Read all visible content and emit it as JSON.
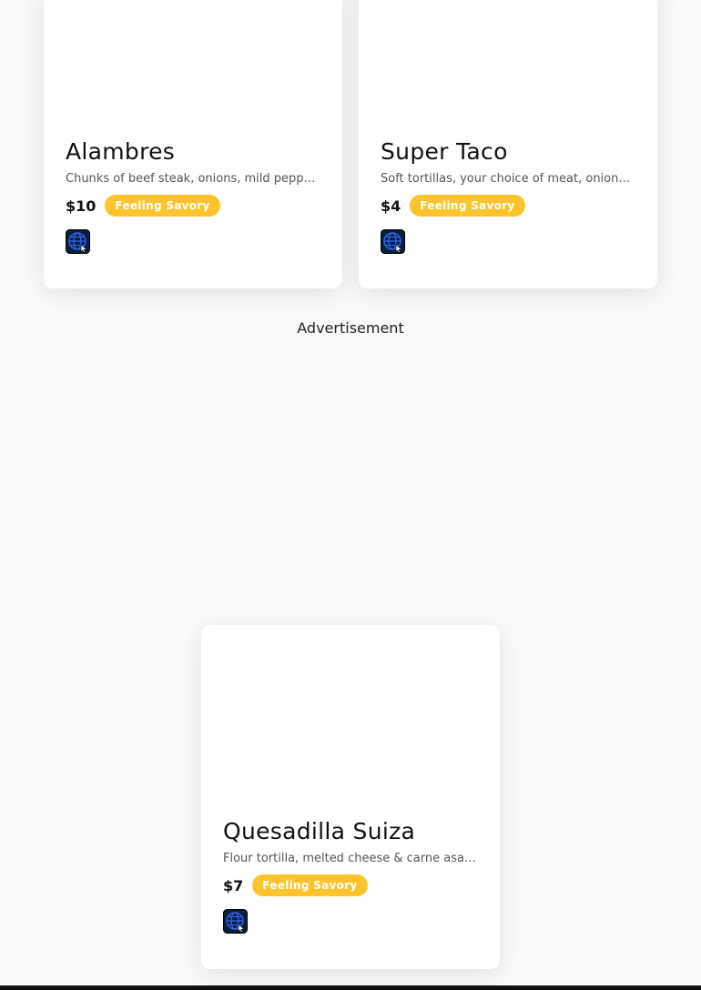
{
  "cards": [
    {
      "title": "Alambres",
      "description": "Chunks of beef steak, onions, mild peppe…",
      "price": "$10",
      "badge": "Feeling Savory",
      "icon": "globe-icon"
    },
    {
      "title": "Super Taco",
      "description": "Soft tortillas, your choice of meat, onions…",
      "price": "$4",
      "badge": "Feeling Savory",
      "icon": "globe-icon"
    },
    {
      "title": "Quesadilla Suiza",
      "description": "Flour tortilla, melted cheese & carne asa…",
      "price": "$7",
      "badge": "Feeling Savory",
      "icon": "globe-icon"
    }
  ],
  "advertisement_label": "Advertisement",
  "colors": {
    "badge": "#fcc42c",
    "background": "#fafafa",
    "card": "#ffffff",
    "icon_bg": "#0b1e3a",
    "icon_grid": "#2f6bff"
  }
}
